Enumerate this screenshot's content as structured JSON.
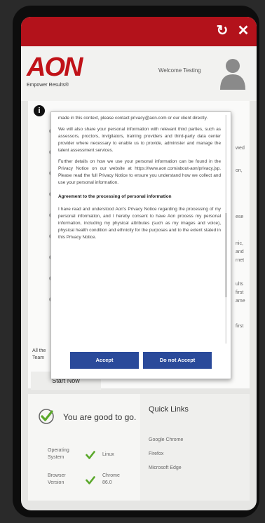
{
  "topbar": {
    "refresh_icon": "refresh-icon",
    "close_icon": "close-icon",
    "color": "#b3121b"
  },
  "header": {
    "logo": "AON",
    "tagline": "Empower Results®",
    "welcome": "Welcome Testing",
    "avatar_icon": "user-avatar-icon"
  },
  "modal": {
    "paragraphs": [
      "made in this context, please contact privacy@aon.com or our client directly.",
      "We will also share your personal information with relevant third parties, such as assessors, proctors, invigilators, training providers and third-party data center provider where necessary to enable us to provide, administer and manage the talent assessment services.",
      "Further details on how we use your personal information can be found in the Privacy Notice on our website at https://www.aon.com/about-aon/privacy.jsp. Please read the full Privacy Notice to ensure you understand how we collect and use your personal information."
    ],
    "heading": "Agreement to the processing of personal information",
    "agreement": "I have read and understood Aon's Privacy Notice regarding the processing of my personal information, and I hereby consent to have Aon process my personal information, including my physical attributes (such as my images and voice), physical health condition and ethnicity for the purposes and to the extent stated in this Privacy Notice.",
    "accept_label": "Accept",
    "decline_label": "Do not Accept",
    "button_color": "#2a4a9a"
  },
  "card": {
    "start_label": "Start Now",
    "bottom_text_1": "All the",
    "bottom_text_2": "Team",
    "side_fragments": [
      "wed",
      "on,",
      "ese",
      "nic,",
      "and",
      "rnet",
      "ults",
      "first",
      "ame",
      "first"
    ]
  },
  "status": {
    "good_text": "You are good to go.",
    "os_label_1": "Operating",
    "os_label_2": "System",
    "os_value": "Linux",
    "browser_label_1": "Browser",
    "browser_label_2": "Version",
    "browser_value_1": "Chrome",
    "browser_value_2": "86.0",
    "check_color": "#5aa82a"
  },
  "quick_links": {
    "title": "Quick Links",
    "links": [
      "Google Chrome",
      "Firefox",
      "Microsoft Edge"
    ]
  }
}
